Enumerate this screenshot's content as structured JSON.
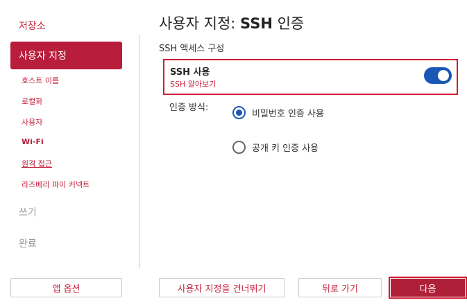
{
  "sidebar": {
    "storage": "저장소",
    "customize": "사용자 지정",
    "subitems": [
      "호스트 이름",
      "로컬화",
      "사용자",
      "Wi-Fi",
      "원격 접근",
      "라즈베리 파이 커넥트"
    ],
    "write": "쓰기",
    "done": "완료",
    "app_options": "앱 옵션"
  },
  "header": {
    "title_prefix": "사용자 지정: ",
    "title_bold": "SSH",
    "title_suffix": " 인증",
    "subtitle": "SSH 액세스 구성"
  },
  "ssh": {
    "label": "SSH 사용",
    "link": "SSH 알아보기",
    "enabled": true
  },
  "auth": {
    "label": "인증 방식:",
    "options": [
      "비밀번호 인증 사용",
      "공개 키 인증 사용"
    ],
    "selected_index": 0
  },
  "footer": {
    "skip": "사용자 지정을 건너뛰기",
    "back": "뒤로 가기",
    "next": "다음"
  },
  "colors": {
    "accent": "#b81d3b",
    "toggle": "#1b57b6"
  }
}
